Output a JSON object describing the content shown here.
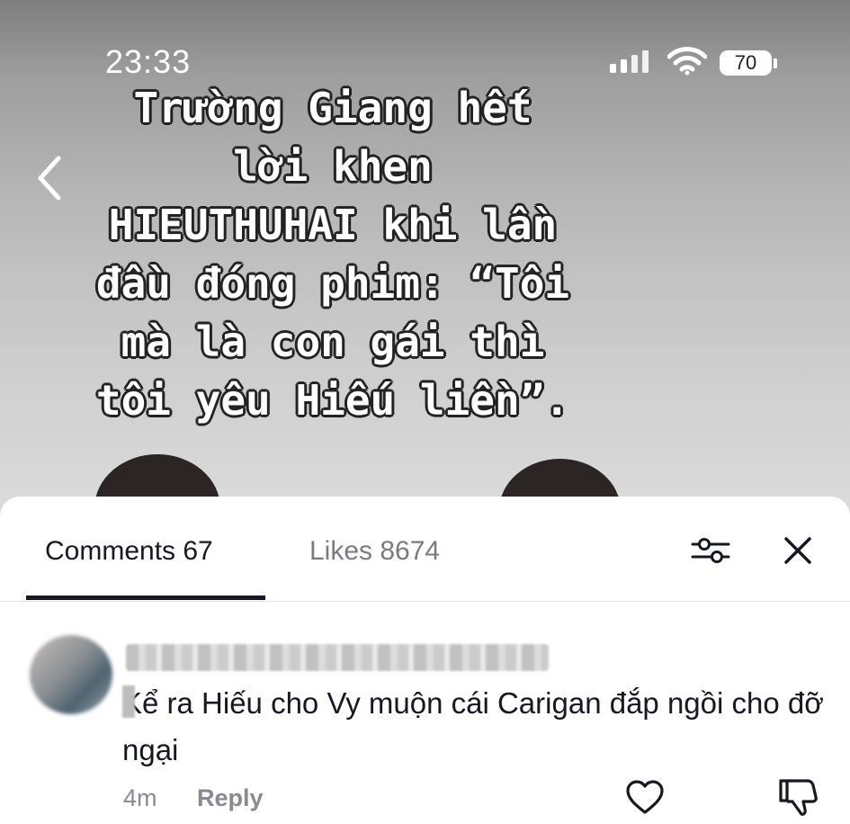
{
  "status_bar": {
    "time": "23:33",
    "battery": "70"
  },
  "video": {
    "caption_lines": [
      "Trường Giang hết",
      "lời khen",
      "HIEUTHUHAI khi lần",
      "đầu đóng phim: “Tôi",
      "mà là con gái thì",
      "tôi yêu Hiếu liền”."
    ]
  },
  "comments_sheet": {
    "tabs": {
      "comments": "Comments 67",
      "likes": "Likes 8674"
    },
    "comment": {
      "text": "Kể ra Hiếu cho Vy muộn cái Carigan đắp ngồi cho đỡ ngại",
      "time": "4m",
      "reply_label": "Reply"
    }
  }
}
